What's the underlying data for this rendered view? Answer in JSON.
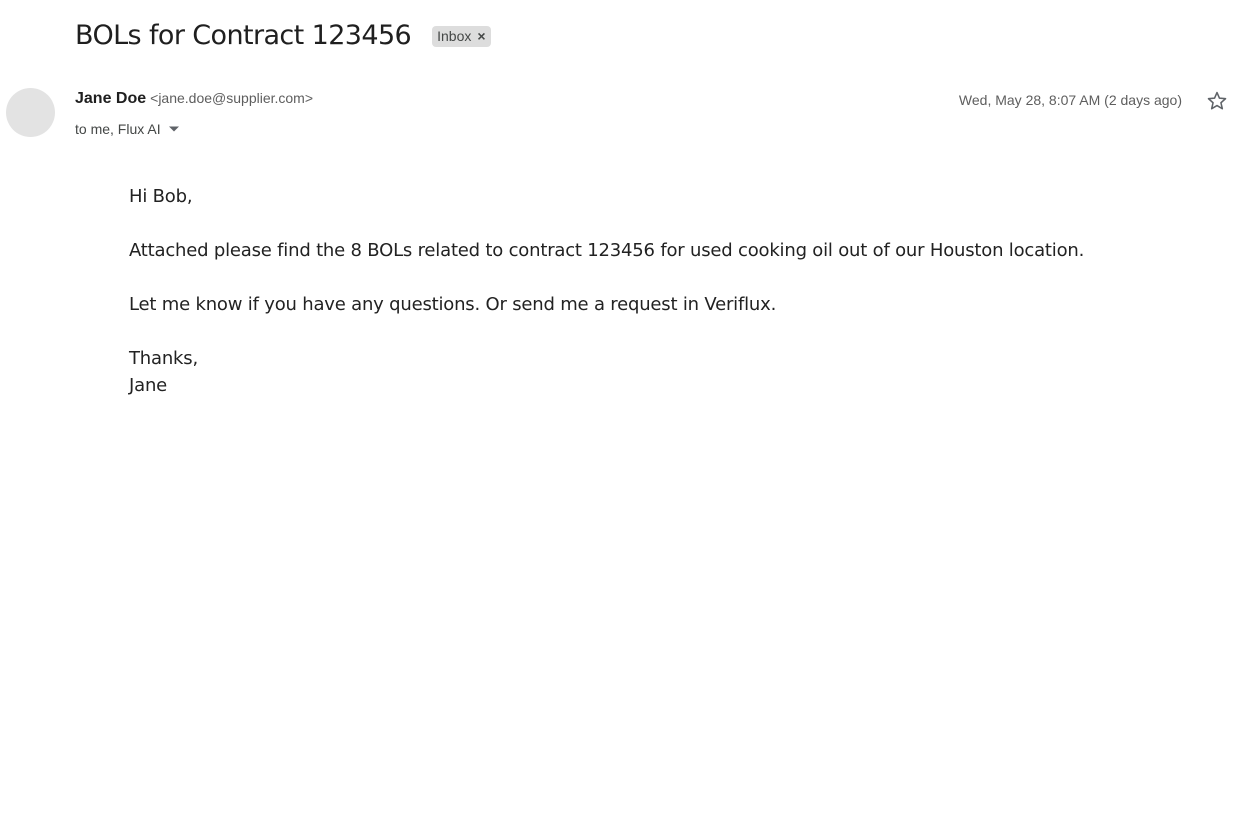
{
  "subject": "BOLs for Contract 123456",
  "label_chip": {
    "text": "Inbox",
    "close_glyph": "×"
  },
  "sender": {
    "name": "Jane Doe",
    "email": "<jane.doe@supplier.com>"
  },
  "recipients": "to me, Flux AI",
  "date": "Wed, May 28, 8:07 AM (2 days ago)",
  "icons": {
    "star": "star-outline-icon",
    "details_toggle": "caret-down-icon"
  },
  "body": {
    "greeting": "Hi Bob,",
    "paragraph1": "Attached please find the 8 BOLs related to contract 123456 for used cooking oil out of our Houston location.",
    "paragraph2": "Let me know if you have any questions. Or send me a request in Veriflux.",
    "closing": "Thanks,",
    "signature": "Jane"
  },
  "colors": {
    "avatar_placeholder": "#e3e3e3",
    "chip_background": "#dddddd",
    "star_outline": "#5f6368"
  }
}
